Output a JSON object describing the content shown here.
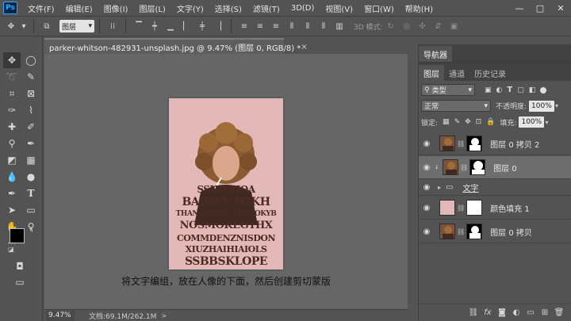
{
  "app": {
    "logo": "Ps",
    "menu": [
      "文件(F)",
      "编辑(E)",
      "图像(I)",
      "图层(L)",
      "文字(Y)",
      "选择(S)",
      "滤镜(T)",
      "3D(D)",
      "视图(V)",
      "窗口(W)",
      "帮助(H)"
    ],
    "window_controls": [
      "—",
      "□",
      "✕"
    ]
  },
  "options_bar": {
    "auto_select_value": "图层",
    "mode_3d_label": "3D 模式:"
  },
  "document": {
    "tab_title": "parker-whitson-482931-unsplash.jpg @ 9.47% (图层 0, RGB/8) *",
    "close_label": "×",
    "text_lines": [
      "SSHO    AIOA",
      "BAIHEV WIKH",
      "THANFDDANT TBNTOKYB",
      "NOSMOKEGYHX",
      "COMMDENZNISDON",
      "XIUZHAIHIAIOLS",
      "SSBBSKLOPE"
    ],
    "caption": "将文字编组，放在人像的下面，然后创建剪切蒙版",
    "background_color": "#e2b9b7"
  },
  "status_bar": {
    "zoom": "9.47%",
    "doc_info": "文档:69.1M/262.1M",
    "arrow": ">"
  },
  "navigator_panel": {
    "title": "导航器"
  },
  "layers_panel": {
    "tabs": [
      "图层",
      "通道",
      "历史记录"
    ],
    "filter_label": "类型",
    "blend_mode": "正常",
    "opacity_label": "不透明度:",
    "opacity_value": "100%",
    "lock_label": "锁定:",
    "fill_label": "填充:",
    "fill_value": "100%",
    "layers": [
      {
        "name": "图层 0 拷贝 2",
        "visible": true,
        "selected": false
      },
      {
        "name": "图层 0",
        "visible": true,
        "selected": true
      },
      {
        "name": "文字",
        "visible": true,
        "selected": false,
        "group": true
      },
      {
        "name": "颜色填充 1",
        "visible": true,
        "selected": false
      },
      {
        "name": "图层 0 拷贝",
        "visible": true,
        "selected": false
      }
    ],
    "bottom_icons": [
      "link-icon",
      "fx-icon",
      "mask-icon",
      "adjustment-icon",
      "folder-icon",
      "new-layer-icon",
      "trash-icon"
    ]
  },
  "colors": {
    "foreground": "#000000",
    "background": "#ffffff"
  }
}
